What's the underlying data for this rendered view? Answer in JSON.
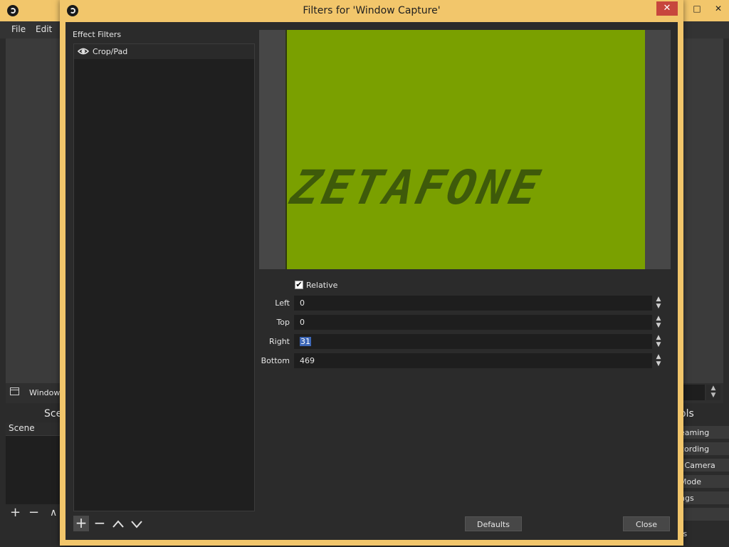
{
  "main": {
    "menu": [
      "File",
      "Edit"
    ],
    "source_label": "Window C",
    "scenes_title": "Sce",
    "scene_column": "Scene",
    "controls_title": "ols",
    "controls": [
      "eaming",
      "cording",
      "l Camera",
      "Mode",
      "ngs",
      "t",
      "ts"
    ]
  },
  "dialog": {
    "title": "Filters for 'Window Capture'",
    "close_glyph": "✕",
    "effect_filters_label": "Effect Filters",
    "filters": [
      {
        "label": "Crop/Pad"
      }
    ],
    "preview_text": "ZETAFONE",
    "relative_label": "Relative",
    "relative_checked": "✔",
    "props": {
      "left": {
        "label": "Left",
        "value": "0"
      },
      "top": {
        "label": "Top",
        "value": "0"
      },
      "right": {
        "label": "Right",
        "value": "31"
      },
      "bottom": {
        "label": "Bottom",
        "value": "469"
      }
    },
    "defaults_label": "Defaults",
    "close_label": "Close"
  },
  "colors": {
    "titlebar": "#f2c66b",
    "panel": "#2b2b2b",
    "preview_green": "#7aa000",
    "preview_text": "#3e5a0a",
    "close_red": "#c7463d",
    "selection": "#3d67b7"
  }
}
